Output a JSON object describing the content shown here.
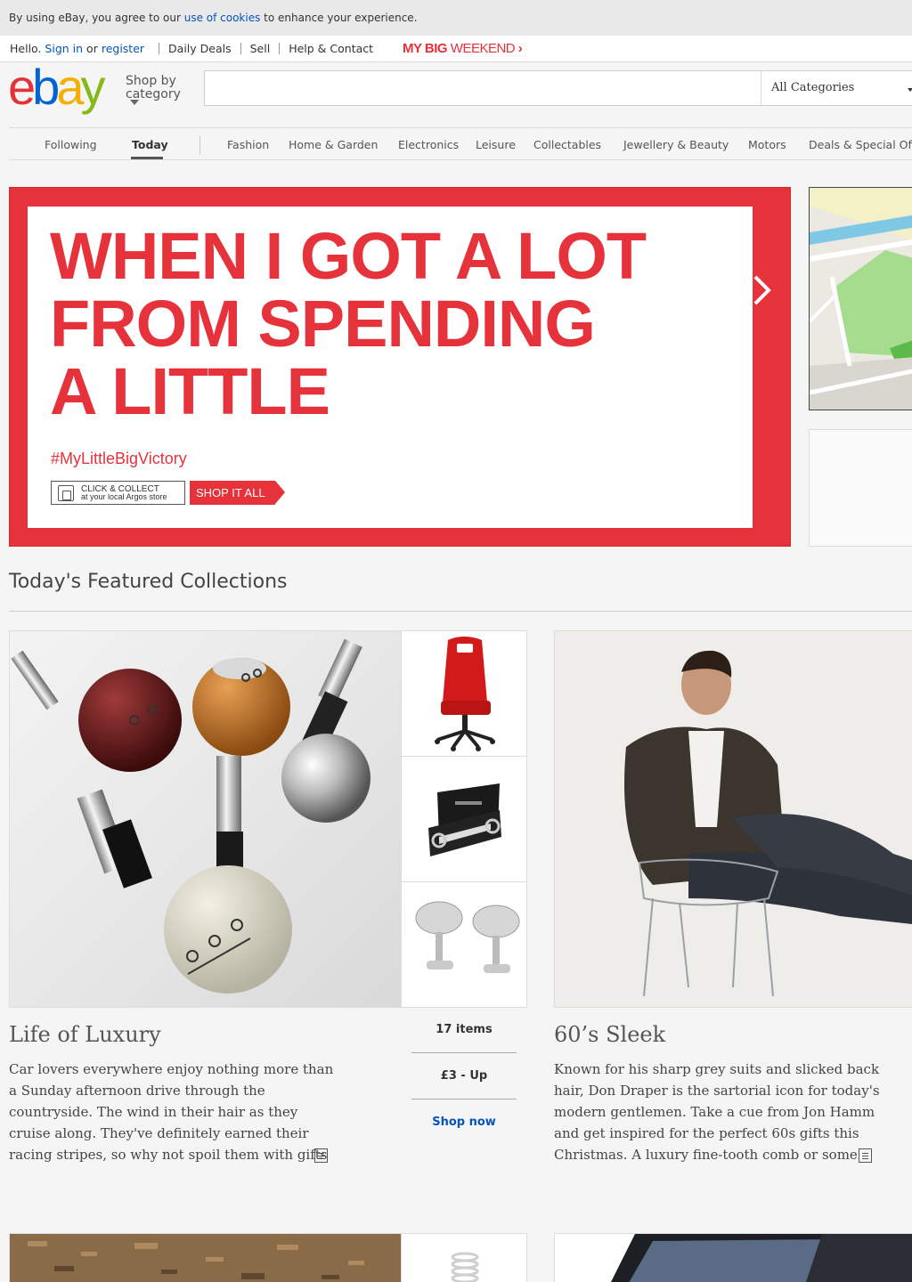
{
  "cookie": {
    "pre": "By using eBay, you agree to our ",
    "link": "use of cookies",
    "post": " to enhance your experience."
  },
  "topnav": {
    "hello": "Hello.",
    "sign_in": "Sign in",
    "or": "or",
    "register": "register",
    "daily_deals": "Daily Deals",
    "sell": "Sell",
    "help": "Help & Contact",
    "promo_bold": "MY BIG",
    "promo_thin": "WEEKEND",
    "promo_arrow": "›"
  },
  "header": {
    "logo": [
      "e",
      "b",
      "a",
      "y"
    ],
    "shop_by_line1": "Shop by",
    "shop_by_line2": "category",
    "search_placeholder": "",
    "category_select": "All Categories"
  },
  "catnav": {
    "items": [
      "Following",
      "Today",
      "Fashion",
      "Home & Garden",
      "Electronics",
      "Leisure",
      "Collectables",
      "Jewellery & Beauty",
      "Motors",
      "Deals & Special Off"
    ],
    "active": "Today"
  },
  "hero": {
    "title": "WHEN I GOT A LOT\nFROM SPENDING\nA LITTLE",
    "hashtag": "#MyLittleBigVictory",
    "cc_line1": "CLICK & COLLECT",
    "cc_line2": "at your local Argos store",
    "button": "SHOP IT ALL"
  },
  "featured": {
    "title": "Today's Featured Collections",
    "collections": [
      {
        "title": "Life of Luxury",
        "description": "Car lovers everywhere enjoy nothing more than a Sunday afternoon drive through the countryside. The wind in their hair as they cruise along. They've definitely earned their racing stripes, so why not spoil them with gifts that emulate the",
        "items": "17 items",
        "price": "£3 - Up",
        "cta": "Shop now"
      },
      {
        "title": "60’s Sleek",
        "description": "Known for his sharp grey suits and slicked back hair, Don Draper is the sartorial icon for today's modern gentlemen. Take a cue from Jon Hamm and get inspired for the perfect 60s gifts this Christmas. A luxury fine-tooth comb or some"
      }
    ]
  },
  "colors": {
    "ebay_red": "#e53238",
    "ebay_blue": "#0064d2",
    "ebay_yellow": "#f5af02",
    "ebay_green": "#86b817",
    "link": "#0654ba",
    "hero_red": "#e5323b"
  }
}
